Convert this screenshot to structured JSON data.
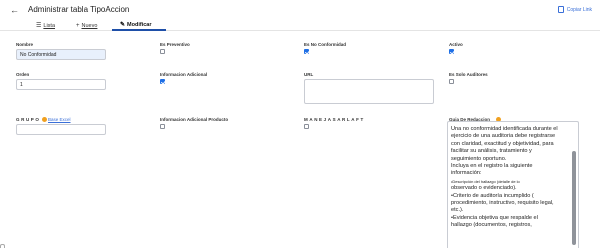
{
  "header": {
    "title": "Administrar tabla TipoAccion",
    "copy_link": "Copiar Link",
    "icons": {
      "back": "arrow-left-icon",
      "copy": "copy-icon"
    }
  },
  "tabs": [
    {
      "label": "Lista",
      "icon": "list-icon",
      "active": false
    },
    {
      "label": "Nuevo",
      "icon": "plus-icon",
      "active": false
    },
    {
      "label": "Modificar",
      "icon": "pencil-icon",
      "active": true
    }
  ],
  "form": {
    "nombre": {
      "label": "Nombre",
      "value": "No Conformidad"
    },
    "es_preventivo": {
      "label": "Es Preventivo",
      "checked": false
    },
    "es_no_conformidad": {
      "label": "Es No Conformidad",
      "checked": true
    },
    "activo": {
      "label": "Activo",
      "checked": true
    },
    "orden": {
      "label": "Orden",
      "value": "1"
    },
    "informacion_adicional": {
      "label": "Informacion Adicional",
      "checked": true
    },
    "url": {
      "label": "URL",
      "value": ""
    },
    "es_solo_auditores": {
      "label": "Es Solo Auditores",
      "checked": false
    },
    "grupo": {
      "label": "GRUPO",
      "link": "Base Excel",
      "value": ""
    },
    "info_adicional_producto": {
      "label": "Informacion Adicional Producto",
      "checked": false
    },
    "manejasarlaft": {
      "label": "MANEJASARLAFT",
      "checked": false
    },
    "guia": {
      "label": "Guia De Redaccion",
      "lines": [
        "Una no conformidad identificada durante el",
        "ejercicio de una auditoria debe registrarse",
        "con claridad, exactitud y objetividad, para",
        "facilitar su análisis, tratamiento y",
        "seguimiento oportuno.",
        "Incluya en el registro la siguiente",
        "información:",
        "•Descripción del hallazgo (detalle de lo",
        "observado o evidenciado).",
        "•Criterio de auditoría incumplido (",
        "procedimiento, instructivo, requisito legal,",
        "etc.).",
        "•Evidencia objetiva que respalde el",
        "hallazgo (documentos, registros,"
      ]
    }
  }
}
